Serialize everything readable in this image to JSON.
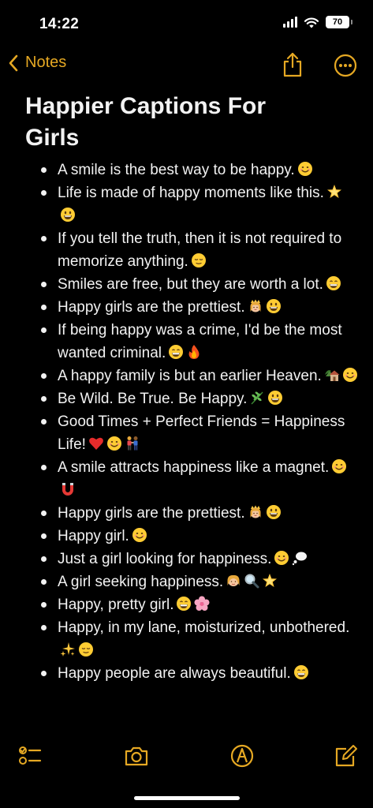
{
  "status_bar": {
    "time": "14:22",
    "battery": "70"
  },
  "nav": {
    "back_label": "Notes",
    "accent_color": "#E5A823",
    "icons": [
      "chevron-left-icon",
      "share-icon",
      "more-icon"
    ]
  },
  "note": {
    "title": "Happier Captions For Girls",
    "items": [
      {
        "text": "A smile is the best way to be happy.",
        "emojis": [
          "smiling-face"
        ]
      },
      {
        "text": "Life is made of happy moments like this.",
        "emojis": [
          "star",
          "grinning-face"
        ]
      },
      {
        "text": "If you tell the truth, then it is not required to memorize anything.",
        "emojis": [
          "relieved-face"
        ]
      },
      {
        "text": "Smiles are free, but they are worth a lot.",
        "emojis": [
          "beaming-face"
        ]
      },
      {
        "text": "Happy girls are the prettiest.",
        "emojis": [
          "princess",
          "grinning-face"
        ]
      },
      {
        "text": "If being happy was a crime, I'd be the most wanted criminal.",
        "emojis": [
          "beaming-face",
          "fire"
        ]
      },
      {
        "text": "A happy family is but an earlier Heaven.",
        "emojis": [
          "house",
          "smiling-face"
        ]
      },
      {
        "text": "Be Wild. Be True. Be Happy.",
        "emojis": [
          "herb",
          "grinning-face"
        ]
      },
      {
        "text": "Good Times + Perfect Friends = Happiness Life!",
        "emojis": [
          "red-heart",
          "smiling-face",
          "couple"
        ]
      },
      {
        "text": "A smile attracts happiness like a magnet.",
        "emojis": [
          "smiling-face",
          "magnet"
        ]
      },
      {
        "text": "Happy girls are the prettiest.",
        "emojis": [
          "princess",
          "grinning-face"
        ]
      },
      {
        "text": "Happy girl.",
        "emojis": [
          "smiling-face"
        ]
      },
      {
        "text": "Just a girl looking for happiness.",
        "emojis": [
          "smiling-face",
          "thought-balloon"
        ]
      },
      {
        "text": "A girl seeking happiness.",
        "emojis": [
          "girl",
          "magnifying-glass",
          "star"
        ]
      },
      {
        "text": "Happy, pretty girl.",
        "emojis": [
          "beaming-face",
          "cherry-blossom"
        ]
      },
      {
        "text": "Happy, in my lane, moisturized, unbothered.",
        "emojis": [
          "sparkles",
          "relieved-face"
        ]
      },
      {
        "text": "Happy people are always beautiful.",
        "emojis": [
          "beaming-face"
        ]
      }
    ]
  },
  "toolbar": {
    "icons": [
      "checklist-icon",
      "camera-icon",
      "markup-icon",
      "compose-icon"
    ]
  }
}
